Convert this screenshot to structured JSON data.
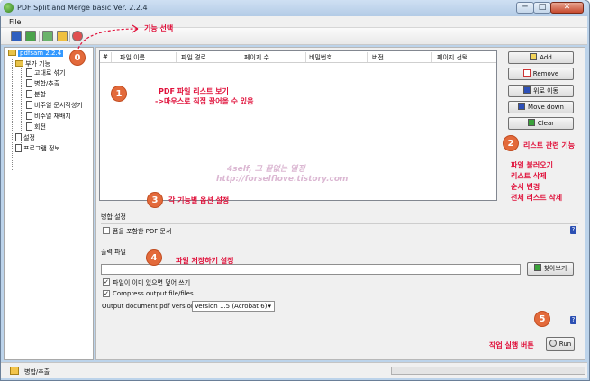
{
  "window": {
    "title": "PDF Split and Merge basic Ver. 2.2.4",
    "min_glyph": "─",
    "max_glyph": "□",
    "close_glyph": "✕"
  },
  "menu": {
    "file": "File"
  },
  "tree": {
    "root": "pdfsam 2.2.4",
    "plugins_folder": "부가 기능",
    "plugins": [
      "고대로 섞기",
      "병합/추출",
      "분할",
      "비주얼 문서작성기",
      "비주얼 재배치",
      "회전"
    ],
    "settings": "설정",
    "info": "프로그램 정보"
  },
  "table": {
    "columns": [
      "#",
      "파일 이름",
      "파일 경로",
      "페이지 수",
      "비밀번호",
      "버전",
      "페이지 선택"
    ]
  },
  "buttons": {
    "add": "Add",
    "remove": "Remove",
    "move_up": "위로 이동",
    "move_down": "Move down",
    "clear": "Clear",
    "browse": "찾아보기",
    "run": "Run"
  },
  "merge": {
    "section_label": "병합 설정",
    "forms_checkbox": "폼을 포함한 PDF 문서",
    "forms_checked": false
  },
  "output": {
    "section_label": "출력 파일",
    "destination_value": "",
    "overwrite_label": "파일이 이미 있으면 덮어 쓰기",
    "overwrite_checked": true,
    "compress_label": "Compress output file/files",
    "compress_checked": true,
    "version_label": "Output document pdf version:",
    "version_value": "Version 1.5 (Acrobat 6)"
  },
  "help_glyph": "?",
  "check_glyph": "✓",
  "status": {
    "text": "병합/추출"
  },
  "annotations": {
    "badges": [
      "0",
      "1",
      "2",
      "3",
      "4",
      "5"
    ],
    "a0": "기능 선택",
    "a1_line1": "PDF 파일 리스트 보기",
    "a1_line2": "->마우스로 직접 끌어올 수 있음",
    "a2": "리스트 관련 기능",
    "a2_list": [
      "파일 불러오기",
      "리스트 삭제",
      "순서 변경",
      "전체 리스트 삭제"
    ],
    "a3": "각 기능별 옵션 설정",
    "a4": "파일 저장하기 설정",
    "a5": "작업 실행 버튼"
  },
  "watermark": {
    "line1": "4self, 그 끝없는 열정",
    "line2": "http://forselflove.tistory.com"
  },
  "colors": {
    "annotation": "#e0103a",
    "badge": "#e36a3b",
    "selection": "#3399ff"
  }
}
